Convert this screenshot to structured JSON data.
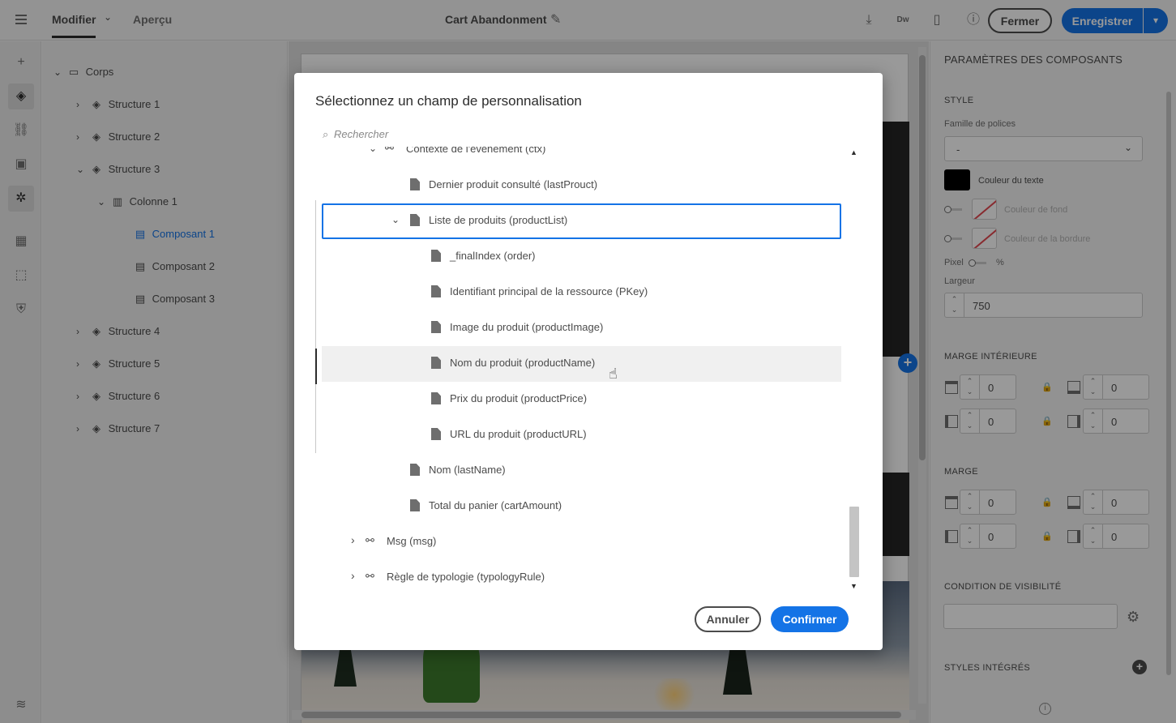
{
  "topbar": {
    "tab_modifier": "Modifier",
    "tab_apercu": "Aperçu",
    "doc_title": "Cart Abandonment",
    "btn_fermer": "Fermer",
    "btn_enregistrer": "Enregistrer",
    "icons": [
      "download-icon",
      "dreamweaver-icon",
      "mobile-preview-icon",
      "help-icon"
    ]
  },
  "tree": {
    "items": [
      {
        "label": "Corps",
        "icon": "folder-icon"
      },
      {
        "label": "Structure 1",
        "icon": "layers-icon"
      },
      {
        "label": "Structure 2",
        "icon": "layers-icon"
      },
      {
        "label": "Structure 3",
        "icon": "layers-icon"
      },
      {
        "label": "Colonne 1",
        "icon": "columns-icon"
      },
      {
        "label": "Composant 1",
        "icon": "component-icon",
        "selected": true
      },
      {
        "label": "Composant 2",
        "icon": "component-icon"
      },
      {
        "label": "Composant 3",
        "icon": "component-icon"
      },
      {
        "label": "Structure 4",
        "icon": "layers-icon"
      },
      {
        "label": "Structure 5",
        "icon": "layers-icon"
      },
      {
        "label": "Structure 6",
        "icon": "layers-icon"
      },
      {
        "label": "Structure 7",
        "icon": "layers-icon"
      }
    ]
  },
  "props": {
    "title": "PARAMÈTRES DES COMPOSANTS",
    "style_section": "STYLE",
    "font_family_label": "Famille de polices",
    "font_family_value": "-",
    "text_color_label": "Couleur du texte",
    "text_color": "#000000",
    "bg_color_label": "Couleur de fond",
    "border_color_label": "Couleur de la bordure",
    "pixel_label": "Pixel",
    "percent_label": "%",
    "width_label": "Largeur",
    "width_value": "750",
    "padding_section": "MARGE INTÉRIEURE",
    "padding_values": [
      "0",
      "0",
      "0",
      "0"
    ],
    "margin_section": "MARGE",
    "margin_values": [
      "0",
      "0",
      "0",
      "0"
    ],
    "visibility_section": "CONDITION DE VISIBILITÉ",
    "styles_section": "STYLES INTÉGRÉS"
  },
  "modal": {
    "title": "Sélectionnez un champ de personnalisation",
    "search_placeholder": "Rechercher",
    "rows": [
      {
        "label": "Contexte de l'événement (ctx)",
        "kind": "node",
        "expanded": true
      },
      {
        "label": "Dernier produit consulté (lastProuct)",
        "kind": "file"
      },
      {
        "label": "Liste de produits (productList)",
        "kind": "file",
        "expanded": true,
        "focused": true
      },
      {
        "label": "_finalIndex (order)",
        "kind": "file"
      },
      {
        "label": "Identifiant principal de la ressource (PKey)",
        "kind": "file"
      },
      {
        "label": "Image du produit (productImage)",
        "kind": "file"
      },
      {
        "label": "Nom du produit (productName)",
        "kind": "file",
        "hovered": true
      },
      {
        "label": "Prix du produit (productPrice)",
        "kind": "file"
      },
      {
        "label": "URL du produit (productURL)",
        "kind": "file"
      },
      {
        "label": "Nom (lastName)",
        "kind": "file"
      },
      {
        "label": "Total du panier (cartAmount)",
        "kind": "file"
      },
      {
        "label": "Msg (msg)",
        "kind": "node",
        "expanded": false
      },
      {
        "label": "Règle de typologie (typologyRule)",
        "kind": "node",
        "expanded": false
      }
    ],
    "btn_cancel": "Annuler",
    "btn_confirm": "Confirmer"
  },
  "colors": {
    "accent": "#1473e6",
    "overlay": "rgba(0,0,0,0.4)"
  }
}
